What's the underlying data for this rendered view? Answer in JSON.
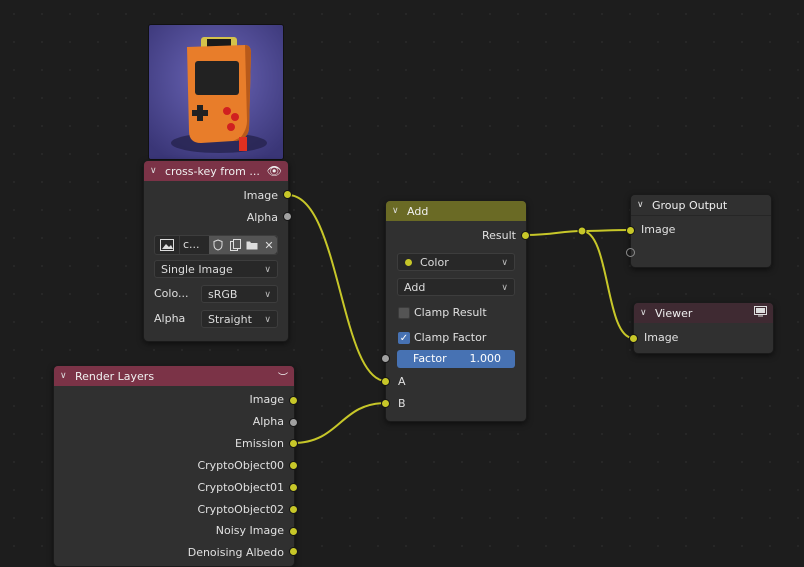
{
  "image_node": {
    "title": "cross-key from ...",
    "outputs": [
      "Image",
      "Alpha"
    ],
    "image_name": "c...",
    "source": "Single Image",
    "color_label": "Colo...",
    "color_value": "sRGB",
    "alpha_label": "Alpha",
    "alpha_value": "Straight"
  },
  "render_layers": {
    "title": "Render Layers",
    "outputs": [
      "Image",
      "Alpha",
      "Emission",
      "CryptoObject00",
      "CryptoObject01",
      "CryptoObject02",
      "Noisy Image",
      "Denoising Albedo"
    ]
  },
  "add_node": {
    "title": "Add",
    "output": "Result",
    "data_type": "Color",
    "operation": "Add",
    "clamp_result": "Clamp Result",
    "clamp_factor": "Clamp Factor",
    "factor_label": "Factor",
    "factor_value": "1.000",
    "input_a": "A",
    "input_b": "B"
  },
  "group_output": {
    "title": "Group Output",
    "input": "Image"
  },
  "viewer": {
    "title": "Viewer",
    "input": "Image"
  },
  "colors": {
    "image_header": "#7b3347",
    "render_header": "#7b3347",
    "add_header": "#6a6a25",
    "group_header": "#303030",
    "viewer_header": "#3f2a32",
    "socket_color": "#c7c729",
    "wire": "#c7c729"
  }
}
